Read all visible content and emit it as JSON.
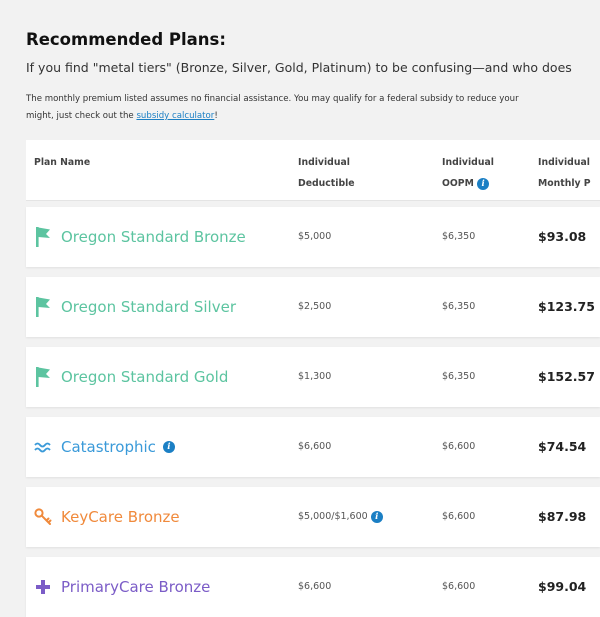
{
  "header": {
    "title": "Recommended Plans:",
    "intro": "If you find \"metal tiers\" (Bronze, Silver, Gold, Platinum) to be confusing—and who does",
    "note_line1": "The monthly premium listed assumes no financial assistance. You may qualify for a federal subsidy to reduce your",
    "note_line2_prefix": "might, just check out the ",
    "note_link": "subsidy calculator",
    "note_line2_suffix": "!"
  },
  "table": {
    "columns": {
      "plan_name": "Plan Name",
      "deductible_1": "Individual",
      "deductible_2": "Deductible",
      "oopm_1": "Individual",
      "oopm_2": "OOPM",
      "premium_1": "Individual",
      "premium_2": "Monthly P"
    },
    "rows": [
      {
        "name": "Oregon Standard Bronze",
        "deductible": "$5,000",
        "oopm": "$6,350",
        "premium": "$93.08",
        "color": "#5cc4a0",
        "icon": "flag-icon"
      },
      {
        "name": "Oregon Standard Silver",
        "deductible": "$2,500",
        "oopm": "$6,350",
        "premium": "$123.75",
        "color": "#5cc4a0",
        "icon": "flag-icon"
      },
      {
        "name": "Oregon Standard Gold",
        "deductible": "$1,300",
        "oopm": "$6,350",
        "premium": "$152.57",
        "color": "#5cc4a0",
        "icon": "flag-icon"
      },
      {
        "name": "Catastrophic",
        "deductible": "$6,600",
        "oopm": "$6,600",
        "premium": "$74.54",
        "color": "#3a9ad9",
        "icon": "wave-icon"
      },
      {
        "name": "KeyCare Bronze",
        "deductible": "$5,000/$1,600",
        "oopm": "$6,600",
        "premium": "$87.98",
        "color": "#f08a3c",
        "icon": "key-icon"
      },
      {
        "name": "PrimaryCare Bronze",
        "deductible": "$6,600",
        "oopm": "$6,600",
        "premium": "$99.04",
        "color": "#7b5cc7",
        "icon": "plus-icon"
      }
    ]
  },
  "colors": {
    "link": "#1b7fc4",
    "info_icon": "#1b7fc4",
    "oregon_standard": "#5cc4a0",
    "catastrophic": "#3a9ad9",
    "keycare": "#f08a3c",
    "primarycare": "#7b5cc7"
  }
}
